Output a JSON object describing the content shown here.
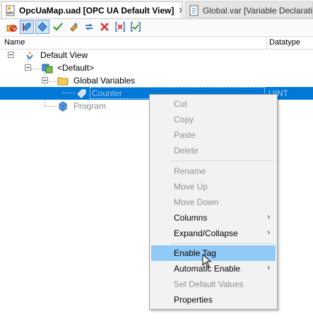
{
  "tabs": [
    {
      "label": "OpcUaMap.uad [OPC UA Default View]",
      "close": "✕",
      "active": true
    },
    {
      "label": "Global.var [Variable Declaration]",
      "active": false
    }
  ],
  "toolbar": {
    "buttons": [
      {
        "name": "map-disable-button",
        "icon": "no-entry-icon"
      },
      {
        "name": "enable-tag-button",
        "icon": "tag-check-icon",
        "pressed": true
      },
      {
        "name": "tag-view-button",
        "icon": "tag-icon",
        "pressed": true
      },
      {
        "name": "check-button",
        "icon": "checkmark-icon"
      },
      {
        "name": "highlight-button",
        "icon": "highlighter-icon"
      },
      {
        "name": "refresh-button",
        "icon": "arrows-icon"
      },
      {
        "name": "delete-button",
        "icon": "x-icon"
      },
      {
        "name": "delete-bracket-button",
        "icon": "bracket-x-icon"
      },
      {
        "name": "check-bracket-button",
        "icon": "bracket-check-icon"
      }
    ]
  },
  "columns": {
    "name": "Name",
    "datatype": "Datatype"
  },
  "tree": {
    "root": "Default View",
    "default_node": "<Default>",
    "global_vars": "Global Variables",
    "counter": "Counter",
    "counter_type": "UINT",
    "program": "Program"
  },
  "menu": {
    "cut": "Cut",
    "copy": "Copy",
    "paste": "Paste",
    "delete": "Delete",
    "rename": "Rename",
    "move_up": "Move Up",
    "move_down": "Move Down",
    "columns": "Columns",
    "expand_collapse": "Expand/Collapse",
    "enable_tag": "Enable Tag",
    "automatic_enable": "Automatic Enable",
    "set_default_values": "Set Default Values",
    "properties": "Properties",
    "submenu_arrow": "›"
  },
  "colors": {
    "selection": "#0078d7",
    "menu_highlight": "#91c9f7",
    "pressed_button": "#cfe5f7"
  }
}
